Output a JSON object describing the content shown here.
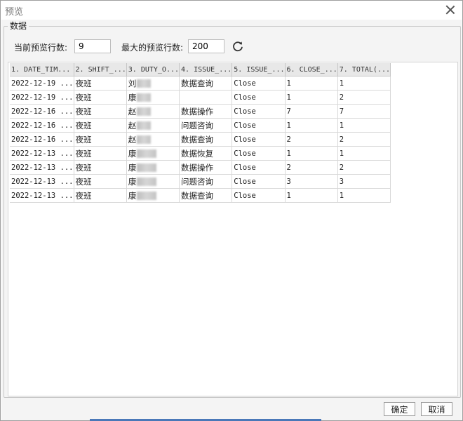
{
  "window": {
    "title": "预览"
  },
  "group": {
    "label": "数据"
  },
  "controls": {
    "current_rows_label": "当前预览行数:",
    "current_rows_value": "9",
    "max_rows_label": "最大的预览行数:",
    "max_rows_value": "200",
    "refresh_icon": "refresh-icon"
  },
  "table": {
    "columns": [
      "1. DATE_TIM...",
      "2. SHIFT_...",
      "3. DUTY_O...",
      "4. ISSUE_...",
      "5. ISSUE_...",
      "6. CLOSE_...",
      "7. TOTAL(..."
    ],
    "rows": [
      {
        "date": "2022-12-19 ...",
        "shift": "夜班",
        "duty": "刘",
        "issue_type": "数据查询",
        "issue_status": "Close",
        "close": "1",
        "total": "1"
      },
      {
        "date": "2022-12-19 ...",
        "shift": "夜班",
        "duty": "康",
        "issue_type": "",
        "issue_status": "Close",
        "close": "1",
        "total": "2"
      },
      {
        "date": "2022-12-16 ...",
        "shift": "夜班",
        "duty": "赵",
        "issue_type": "数据操作",
        "issue_status": "Close",
        "close": "7",
        "total": "7"
      },
      {
        "date": "2022-12-16 ...",
        "shift": "夜班",
        "duty": "赵",
        "issue_type": "问题咨询",
        "issue_status": "Close",
        "close": "1",
        "total": "1"
      },
      {
        "date": "2022-12-16 ...",
        "shift": "夜班",
        "duty": "赵",
        "issue_type": "数据查询",
        "issue_status": "Close",
        "close": "2",
        "total": "2"
      },
      {
        "date": "2022-12-13 ...",
        "shift": "夜班",
        "duty": "康",
        "issue_type": "数据恢复",
        "issue_status": "Close",
        "close": "1",
        "total": "1"
      },
      {
        "date": "2022-12-13 ...",
        "shift": "夜班",
        "duty": "康",
        "issue_type": "数据操作",
        "issue_status": "Close",
        "close": "2",
        "total": "2"
      },
      {
        "date": "2022-12-13 ...",
        "shift": "夜班",
        "duty": "康",
        "issue_type": "问题咨询",
        "issue_status": "Close",
        "close": "3",
        "total": "3"
      },
      {
        "date": "2022-12-13 ...",
        "shift": "夜班",
        "duty": "康",
        "issue_type": "数据查询",
        "issue_status": "Close",
        "close": "1",
        "total": "1"
      }
    ]
  },
  "buttons": {
    "ok": "确定",
    "cancel": "取消"
  },
  "colors": {
    "accent": "#4a78b8",
    "header_bg": "#e8e8e8",
    "dialog_bg": "#f4f4f4"
  }
}
